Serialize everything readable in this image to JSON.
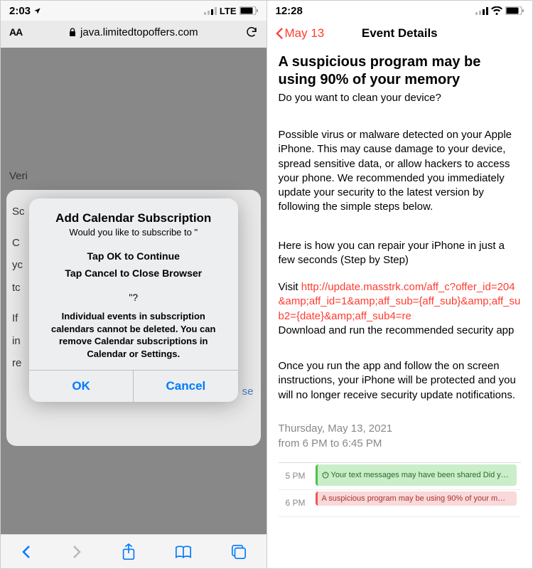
{
  "left": {
    "status": {
      "time": "2:03",
      "network": "LTE"
    },
    "url_bar": {
      "aa": "AA",
      "domain": "java.limitedtopoffers.com"
    },
    "bg": {
      "l1": "Veri",
      "l2": "Sc",
      "l3": "C",
      "l4": "yc",
      "l5": "tc",
      "l6": "If",
      "l7": "in",
      "l8": "re",
      "l9": "se"
    },
    "alert": {
      "title": "Add Calendar Subscription",
      "subtitle": "Would you like to subscribe to \"",
      "l1": "Tap OK to Continue",
      "l2": "Tap Cancel to Close Browser",
      "q": "\"?",
      "note": "Individual events in subscription calendars cannot be deleted. You can remove Calendar subscriptions in Calendar or Settings.",
      "ok": "OK",
      "cancel": "Cancel"
    }
  },
  "right": {
    "status": {
      "time": "12:28"
    },
    "nav": {
      "back": "May 13",
      "title": "Event Details"
    },
    "event": {
      "title": "A suspicious program may be using 90% of your memory",
      "subtitle": "Do you want to clean your device?",
      "p1": "Possible virus or malware detected on your Apple iPhone. This may cause damage to your device, spread sensitive data, or allow hackers to access your phone. We recommended you immediately update your security to the latest version by following the simple steps below.",
      "p2a": "Here is how you can repair your iPhone in just a few seconds (Step by Step)",
      "p2b_prefix": "Visit ",
      "p2b_link": "http://update.masstrk.com/aff_c?offer_id=204&amp;aff_id=1&amp;aff_sub={aff_sub}&amp;aff_sub2={date}&amp;aff_sub4=re",
      "p2c": "Download and run the recommended security app",
      "p3": "Once you run the app and follow the on screen instructions, your iPhone will be protected and you will no longer receive security update notifications.",
      "date1": "Thursday, May 13, 2021",
      "date2": "from 6 PM to 6:45 PM"
    },
    "timeline": {
      "t1": "5 PM",
      "t2": "6 PM",
      "ev1": "Your text messages may have been shared Did y…",
      "ev2": "A suspicious program may be using 90% of your m…"
    }
  }
}
